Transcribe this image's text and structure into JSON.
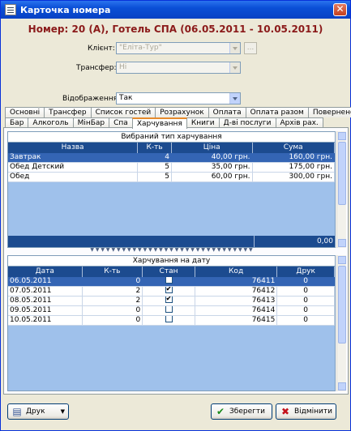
{
  "window": {
    "title": "Карточка номера"
  },
  "header": {
    "title": "Номер: 20 (А), Готель  СПА (06.05.2011 - 10.05.2011)"
  },
  "form": {
    "client_label": "Клієнт:",
    "client_value": "\"Еліта-Тур\"",
    "transfer_label": "Трансфер:",
    "transfer_value": "Ні",
    "display_label": "Відображення:",
    "display_value": "Так",
    "client_btn": "..."
  },
  "tabs_row1": [
    "Основні",
    "Трансфер",
    "Список гостей",
    "Розрахунок",
    "Оплата",
    "Оплата разом",
    "Повернено"
  ],
  "tabs_row2": [
    "Бар",
    "Алкоголь",
    "МінБар",
    "Спа",
    "Харчування",
    "Книги",
    "Д-ві послуги",
    "Архів рах."
  ],
  "active_tab": "Харчування",
  "meal_grid": {
    "caption": "Вибраний тип харчування",
    "columns": [
      "Назва",
      "К-ть",
      "Ціна",
      "Сума"
    ],
    "rows": [
      [
        "Завтрак",
        "4",
        "40,00 грн.",
        "160,00 грн."
      ],
      [
        "Обед Детский",
        "5",
        "35,00 грн.",
        "175,00 грн."
      ],
      [
        "Обед",
        "5",
        "60,00 грн.",
        "300,00 грн."
      ]
    ],
    "total": "0,00"
  },
  "date_grid": {
    "caption": "Харчування на дату",
    "columns": [
      "Дата",
      "К-ть",
      "Стан",
      "Код",
      "Друк"
    ],
    "rows": [
      [
        "06.05.2011",
        "0",
        false,
        "76411",
        "0"
      ],
      [
        "07.05.2011",
        "2",
        true,
        "76412",
        "0"
      ],
      [
        "08.05.2011",
        "2",
        true,
        "76413",
        "0"
      ],
      [
        "09.05.2011",
        "0",
        false,
        "76414",
        "0"
      ],
      [
        "10.05.2011",
        "0",
        false,
        "76415",
        "0"
      ]
    ]
  },
  "buttons": {
    "print": "Друк",
    "save": "Зберегти",
    "cancel": "Відмінити"
  },
  "icons": {
    "app": "window-icon",
    "close": "close-icon",
    "print": "printer-icon",
    "save": "checkmark-icon",
    "cancel": "cross-icon"
  },
  "colors": {
    "title": "#8b1a1a",
    "header_bg": "#1c4b8f",
    "selection": "#3465b4",
    "grid_bg": "#9fc1eb"
  }
}
